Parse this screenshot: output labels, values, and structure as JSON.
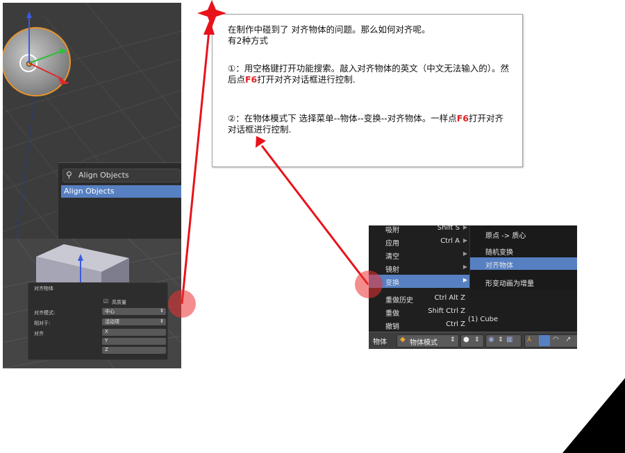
{
  "left_screenshot": {
    "search_text": "Align Objects",
    "search_result": "Align Objects",
    "align_panel": {
      "title": "对齐物体",
      "high_quality_label": "高质量",
      "align_mode_label": "对齐模式:",
      "align_mode_value": "中心",
      "relative_to_label": "相对于:",
      "relative_to_value": "活动项",
      "align_label": "对齐",
      "axes": [
        "X",
        "Y",
        "Z"
      ]
    }
  },
  "note": {
    "line1": "在制作中碰到了 对齐物体的问题。那么如何对齐呢。",
    "line2": "有2种方式",
    "method1_prefix": "①：用空格键打开功能搜索。敲入对齐物体的英文（中文无法输入的）。然后点",
    "method1_key": "F6",
    "method1_suffix": "打开对齐对话框进行控制.",
    "method2_prefix": "②：在物体模式下 选择菜单--物体--变换--对齐物体。一样点",
    "method2_key": "F6",
    "method2_suffix": "打开对齐对话框进行控制."
  },
  "menu_screenshot": {
    "items": [
      {
        "label": "吸附",
        "shortcut": "Shift S",
        "submenu": true
      },
      {
        "label": "应用",
        "shortcut": "Ctrl A",
        "submenu": true
      },
      {
        "label": "清空",
        "shortcut": "",
        "submenu": true
      },
      {
        "label": "镜射",
        "shortcut": "",
        "submenu": true
      },
      {
        "label": "变换",
        "shortcut": "",
        "submenu": true
      },
      {
        "label": "重做历史",
        "shortcut": "Ctrl Alt Z",
        "submenu": false
      },
      {
        "label": "重做",
        "shortcut": "Shift Ctrl Z",
        "submenu": false
      },
      {
        "label": "撤销",
        "shortcut": "Ctrl Z",
        "submenu": false
      }
    ],
    "submenu_items": [
      {
        "label": "原点 -> 质心"
      },
      {
        "label": "随机变换"
      },
      {
        "label": "对齐物体"
      },
      {
        "label": "形变动画为增量"
      }
    ],
    "object_label": "(1) Cube",
    "bottombar": {
      "object_menu": "物体",
      "mode": "物体模式"
    }
  },
  "colors": {
    "arrow_red": "#e8121b",
    "highlight_blue": "#5680c2",
    "f6_red": "#e02020"
  }
}
